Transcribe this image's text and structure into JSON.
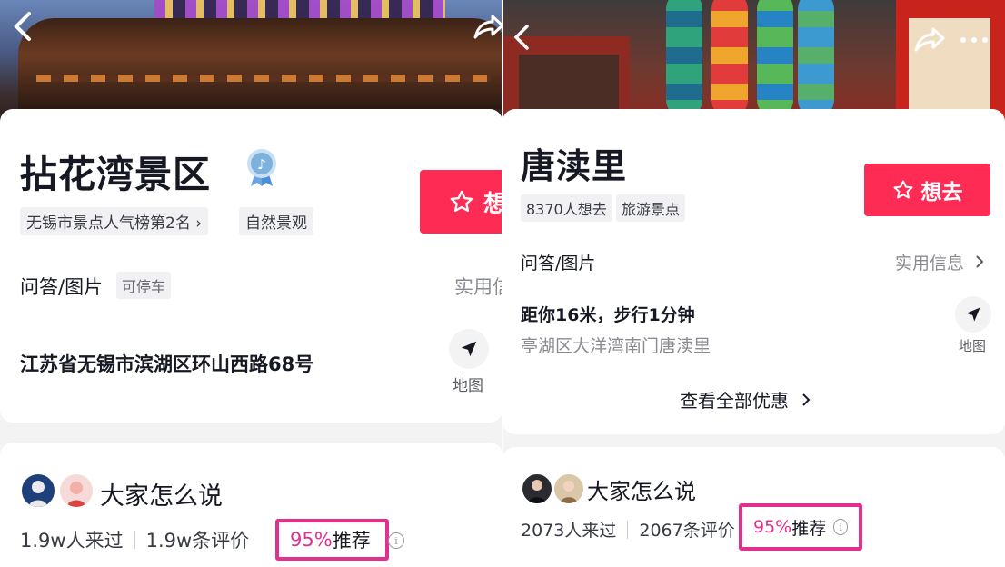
{
  "left": {
    "title": "拈花湾景区",
    "tags": [
      "无锡市景点人气榜第2名 ›",
      "自然景观"
    ],
    "want_label": "想去",
    "qa_label": "问答/图片",
    "parking_tag": "可停车",
    "practical_info": "实用信",
    "address": "江苏省无锡市滨湖区环山西路68号",
    "map_label": "地图",
    "says_title": "大家怎么说",
    "visited": "1.9w人来过",
    "reviews": "1.9w条评价",
    "recommend_pct": "95%",
    "recommend_label": "推荐"
  },
  "right": {
    "title": "唐渎里",
    "tags": [
      "8370人想去",
      "旅游景点"
    ],
    "want_label": "想去",
    "qa_label": "问答/图片",
    "practical_info": "实用信息",
    "distance": "距你16米，步行1分钟",
    "address": "亭湖区大洋湾南门唐渎里",
    "map_label": "地图",
    "all_offers": "查看全部优惠",
    "says_title": "大家怎么说",
    "visited": "2073人来过",
    "reviews": "2067条评价",
    "recommend_pct": "95%",
    "recommend_label": "推荐"
  },
  "icons": {
    "back": "chevron-left-icon",
    "share": "share-arrow-icon",
    "more": "more-dots-icon",
    "badge": "douyin-badge-icon",
    "star": "star-outline-icon",
    "map": "navigation-arrow-icon",
    "info": "info-circle-icon"
  },
  "colors": {
    "brand_red": "#fe2c55",
    "highlight_pink": "#e0318f"
  }
}
